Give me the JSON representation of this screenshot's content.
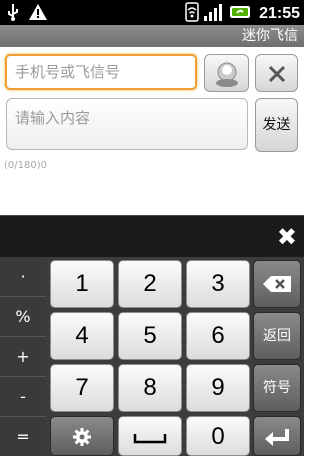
{
  "status_bar": {
    "time": "21:55",
    "icons": [
      "usb-icon",
      "warning-icon",
      "wifi-icon",
      "signal-icon",
      "battery-icon"
    ]
  },
  "title_bar": {
    "title": "迷你飞信"
  },
  "compose": {
    "phone_placeholder": "手机号或飞信号",
    "content_placeholder": "请输入内容",
    "send_label": "发送",
    "counter": "(0/180)0"
  },
  "keyboard": {
    "close_label": "✖",
    "side_keys": [
      "·",
      "%",
      "+",
      "-",
      "="
    ],
    "digits": [
      [
        "1",
        "2",
        "3"
      ],
      [
        "4",
        "5",
        "6"
      ],
      [
        "7",
        "8",
        "9"
      ]
    ],
    "zero": "0",
    "back_label": "返回",
    "symbol_label": "符号",
    "accent_color": "#f0a033"
  }
}
